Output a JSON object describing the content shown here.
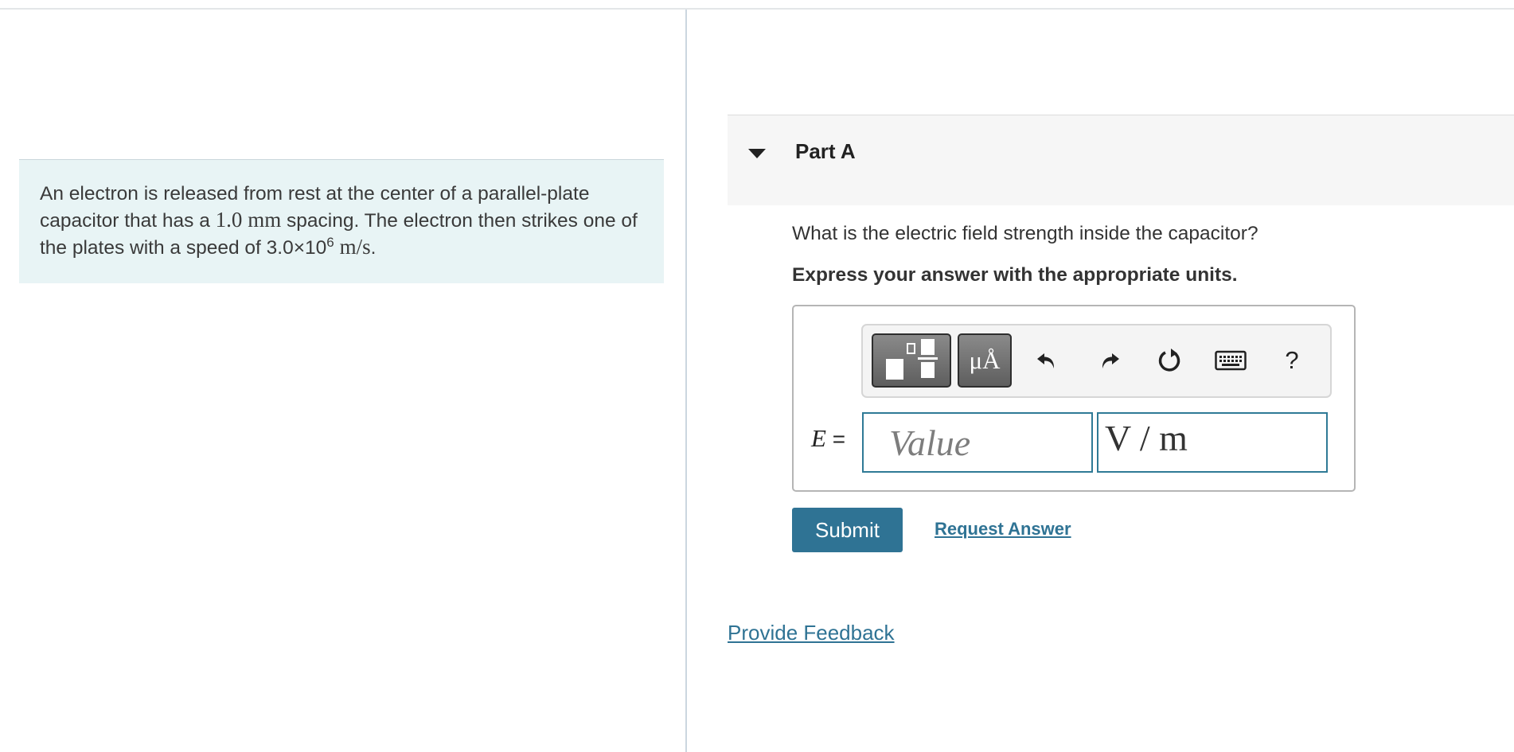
{
  "problem": {
    "text_1": "An electron is released from rest at the center of a parallel-plate capacitor that has a ",
    "spacing_value": "1.0",
    "spacing_unit": "mm",
    "text_2": " spacing. The electron then strikes one of the plates with a speed of ",
    "speed_mantissa": "3.0×10",
    "speed_exponent": "6",
    "speed_unit": "m/s",
    "text_3": "."
  },
  "part": {
    "title": "Part A",
    "question": "What is the electric field strength inside the capacitor?",
    "instruction": "Express your answer with the appropriate units."
  },
  "toolbar": {
    "templates_icon": "templates-icon",
    "units_label": "μÅ",
    "undo_icon": "undo-icon",
    "redo_icon": "redo-icon",
    "reset_icon": "reset-icon",
    "keyboard_icon": "keyboard-icon",
    "help_label": "?"
  },
  "answer": {
    "variable": "E",
    "equals": "=",
    "value_placeholder": "Value",
    "units_value": "V / m"
  },
  "actions": {
    "submit_label": "Submit",
    "request_answer_label": "Request Answer",
    "feedback_label": "Provide Feedback"
  },
  "colors": {
    "accent": "#2f7394",
    "problem_background": "#e8f4f5",
    "part_header_background": "#f6f6f6"
  }
}
